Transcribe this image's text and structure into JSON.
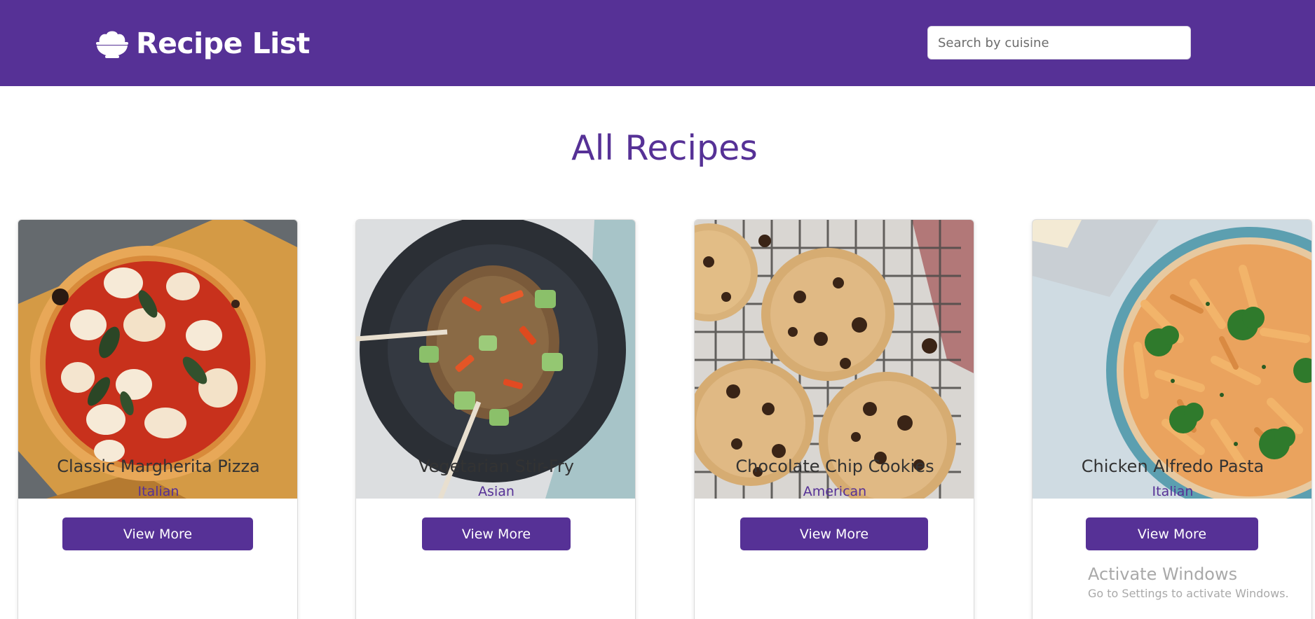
{
  "header": {
    "brand_icon": "rice-bowl-icon",
    "title": "Recipe List",
    "search_placeholder": "Search by cuisine"
  },
  "main": {
    "heading": "All Recipes",
    "recipes": [
      {
        "title": "Classic Margherita Pizza",
        "cuisine": "Italian",
        "button_label": "View More",
        "image": "margherita-pizza-photo"
      },
      {
        "title": "Vegetarian Stir-Fry",
        "cuisine": "Asian",
        "button_label": "View More",
        "image": "vegetable-stir-fry-photo"
      },
      {
        "title": "Chocolate Chip Cookies",
        "cuisine": "American",
        "button_label": "View More",
        "image": "chocolate-chip-cookies-photo"
      },
      {
        "title": "Chicken Alfredo Pasta",
        "cuisine": "Italian",
        "button_label": "View More",
        "image": "chicken-alfredo-pasta-photo"
      }
    ]
  },
  "watermark": {
    "title": "Activate Windows",
    "subtitle": "Go to Settings to activate Windows."
  },
  "colors": {
    "brand": "#563196",
    "text_dark": "#333333",
    "background": "#ffffff"
  }
}
